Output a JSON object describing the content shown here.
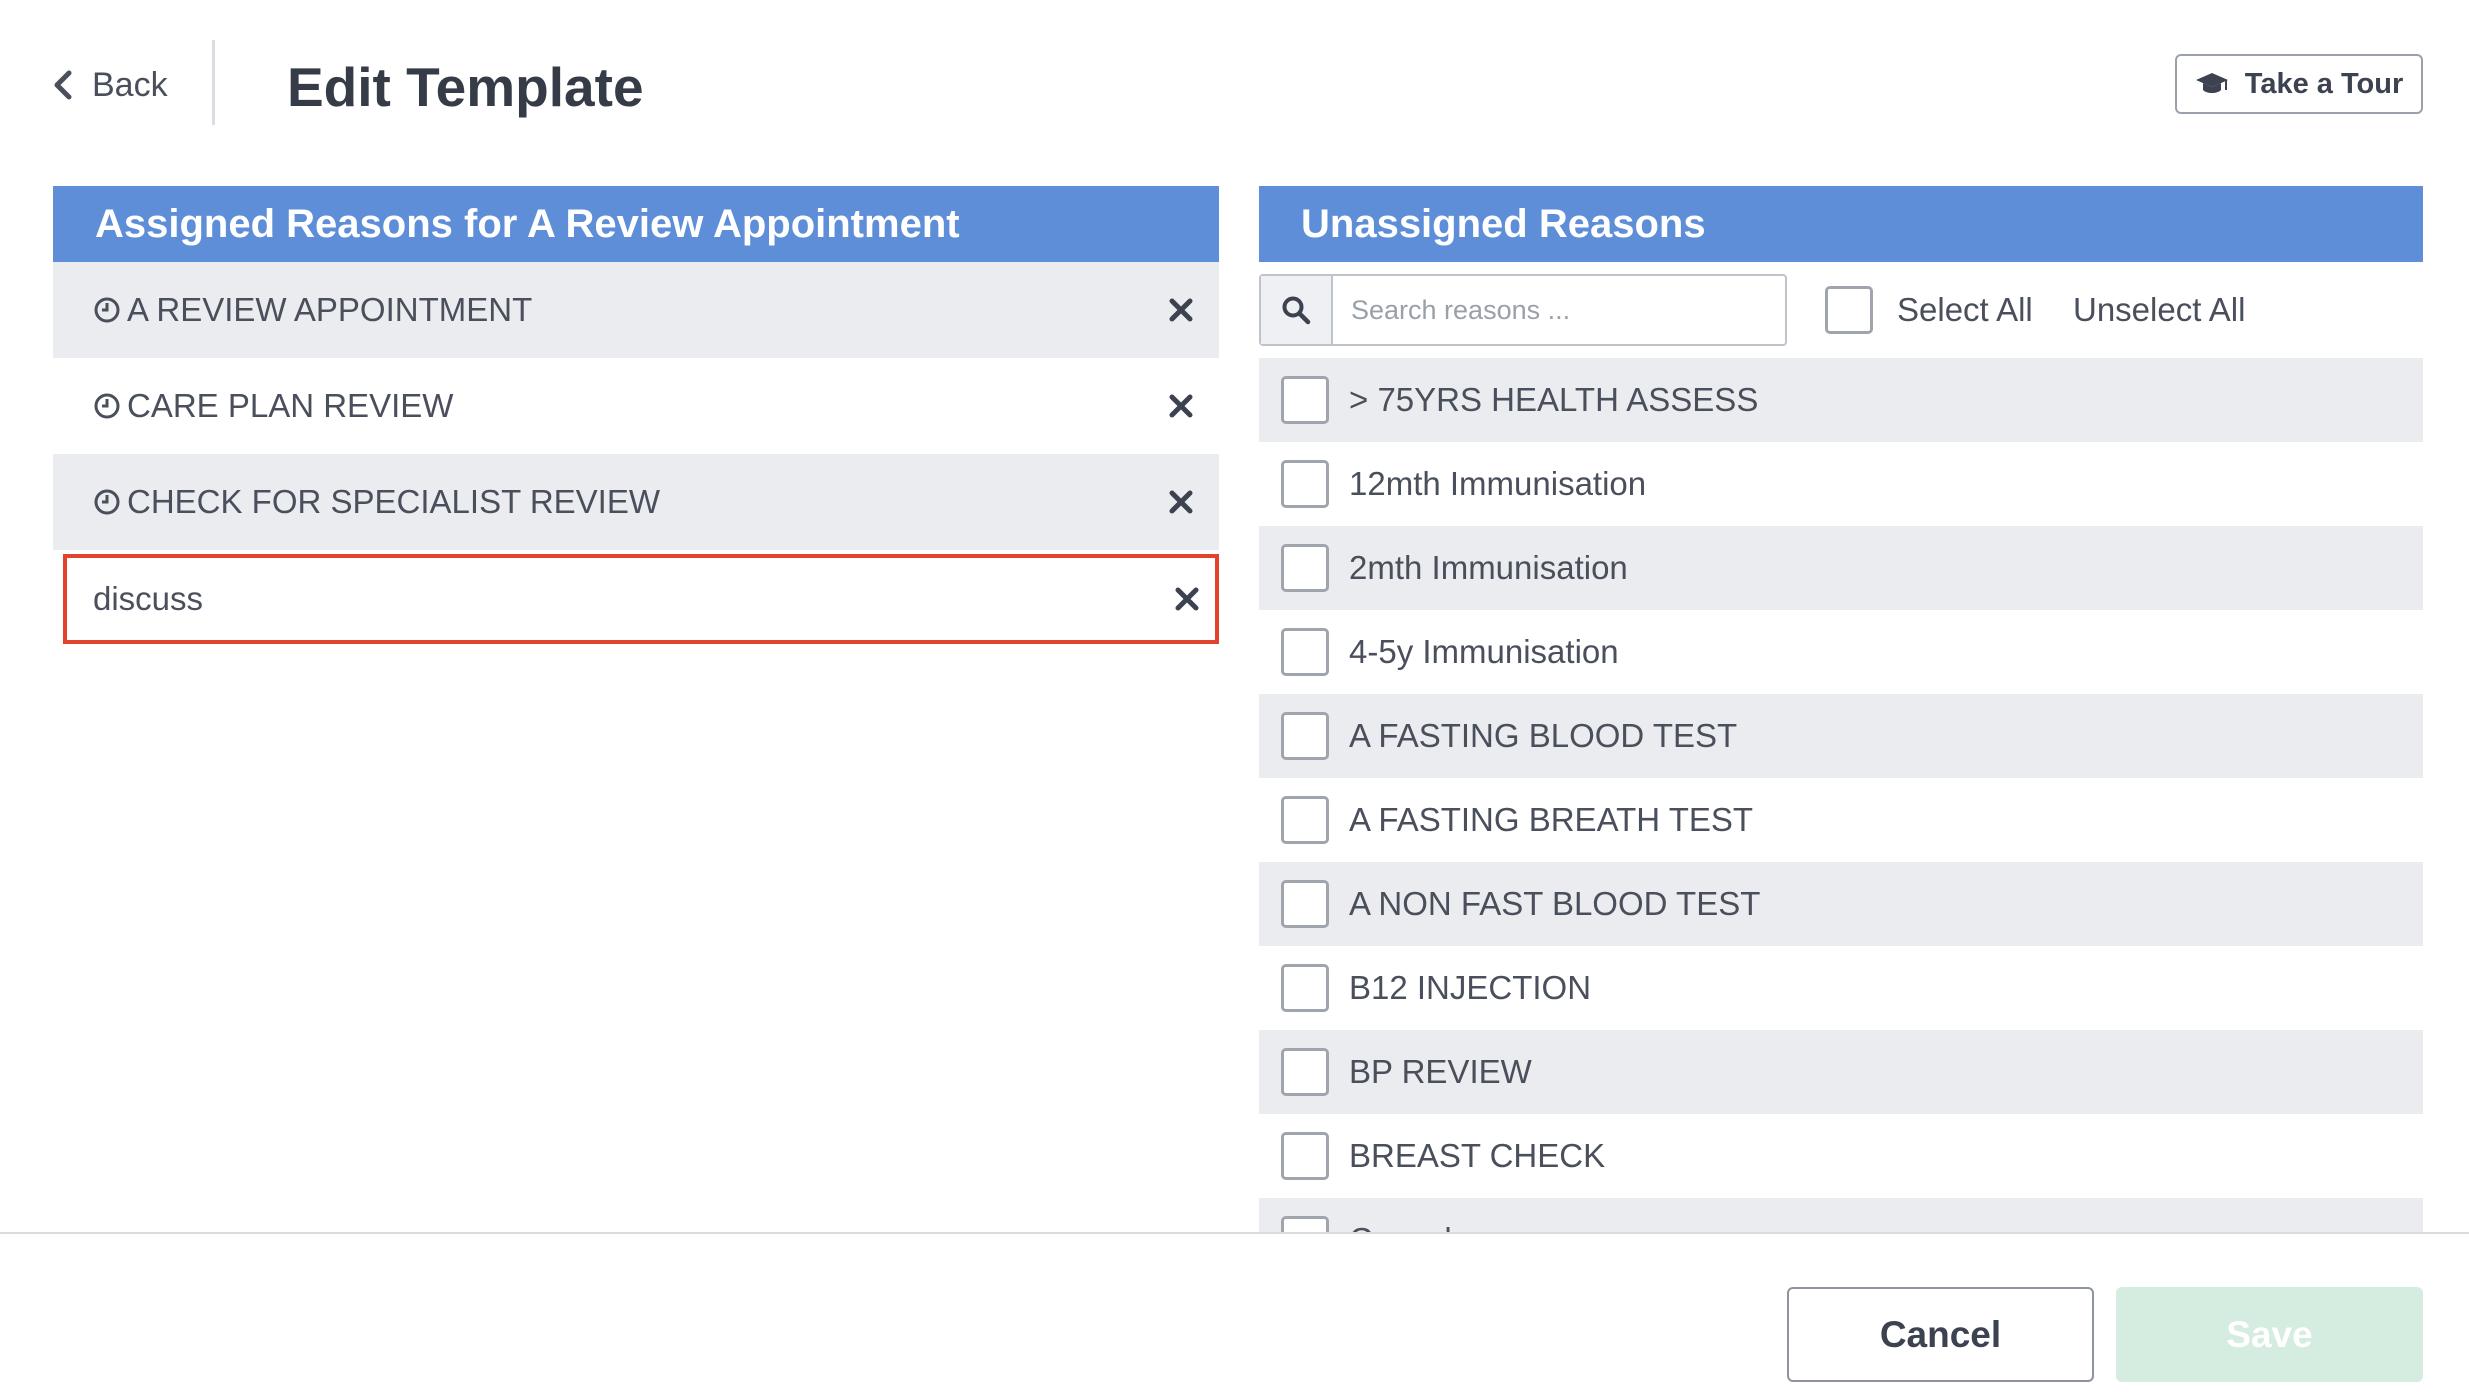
{
  "header": {
    "back_label": "Back",
    "title": "Edit Template",
    "tour_label": "Take a Tour"
  },
  "assigned": {
    "heading": "Assigned Reasons for A Review Appointment",
    "items": [
      {
        "label": "A REVIEW APPOINTMENT",
        "icon": "clock-icon"
      },
      {
        "label": "CARE PLAN REVIEW",
        "icon": "clock-icon"
      },
      {
        "label": "CHECK FOR SPECIALIST REVIEW",
        "icon": "clock-icon"
      },
      {
        "label": "discuss",
        "icon": null,
        "highlighted": true
      }
    ]
  },
  "unassigned": {
    "heading": "Unassigned Reasons",
    "search_placeholder": "Search reasons ...",
    "select_all_label": "Select All",
    "unselect_all_label": "Unselect All",
    "items": [
      "> 75YRS HEALTH ASSESS",
      "12mth Immunisation",
      "2mth Immunisation",
      "4-5y Immunisation",
      "A FASTING BLOOD TEST",
      "A FASTING BREATH TEST",
      "A NON FAST BLOOD TEST",
      "B12 INJECTION",
      "BP REVIEW",
      "BREAST CHECK",
      "Cancel"
    ]
  },
  "footer": {
    "cancel_label": "Cancel",
    "save_label": "Save"
  },
  "colors": {
    "panel_header": "#5e8ed7",
    "highlight_border": "#e2432b",
    "save_disabled": "#d5ece0",
    "row_stripe": "#ebecef"
  }
}
